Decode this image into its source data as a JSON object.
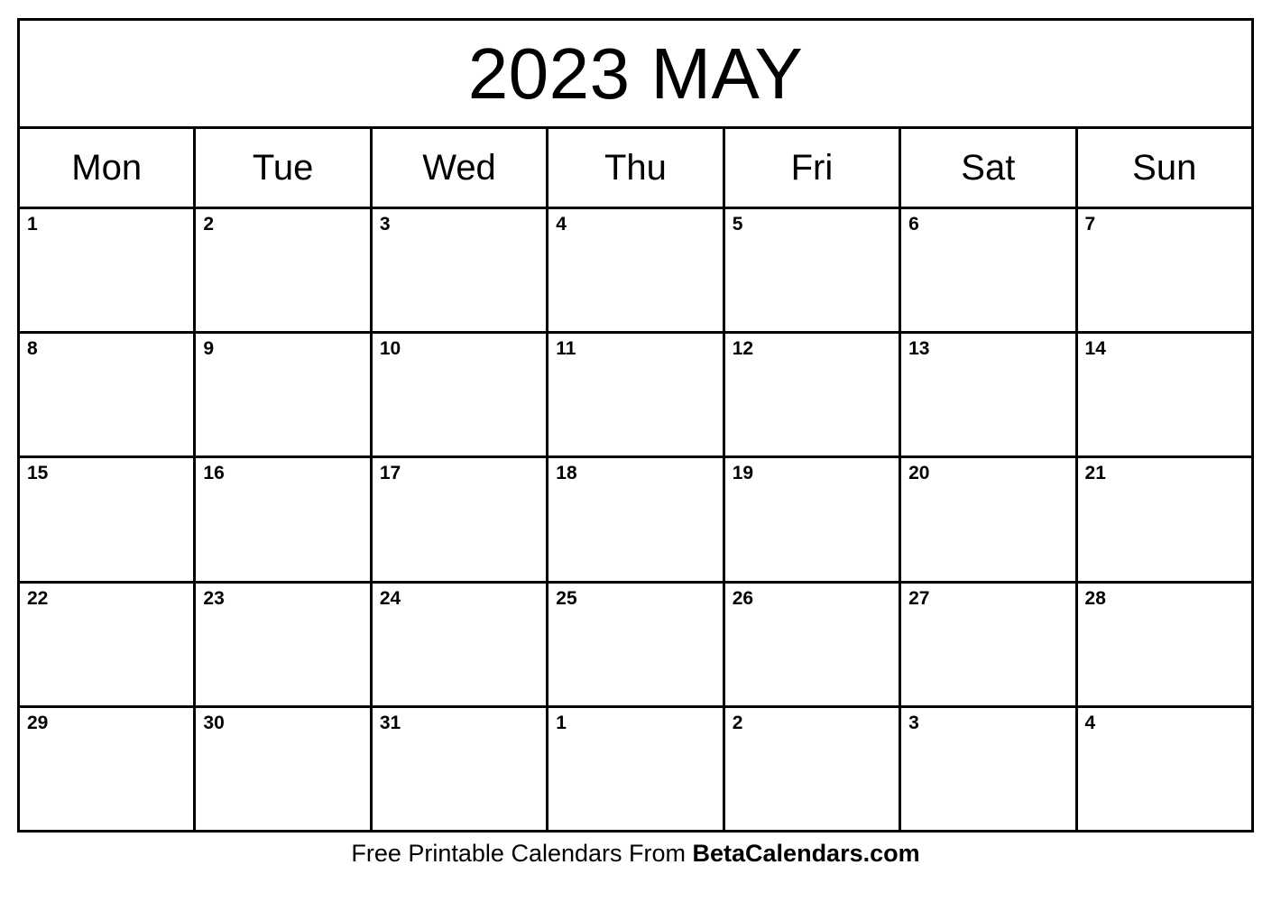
{
  "calendar": {
    "title": "2023 MAY",
    "year": "2023",
    "month": "MAY",
    "weekday_headers": [
      "Mon",
      "Tue",
      "Wed",
      "Thu",
      "Fri",
      "Sat",
      "Sun"
    ],
    "weeks": [
      [
        "1",
        "2",
        "3",
        "4",
        "5",
        "6",
        "7"
      ],
      [
        "8",
        "9",
        "10",
        "11",
        "12",
        "13",
        "14"
      ],
      [
        "15",
        "16",
        "17",
        "18",
        "19",
        "20",
        "21"
      ],
      [
        "22",
        "23",
        "24",
        "25",
        "26",
        "27",
        "28"
      ],
      [
        "29",
        "30",
        "31",
        "1",
        "2",
        "3",
        "4"
      ]
    ],
    "colors": {
      "border": "#000000",
      "background": "#ffffff",
      "text": "#000000"
    }
  },
  "footer": {
    "prefix": "Free Printable Calendars From ",
    "brand": "BetaCalendars.com"
  }
}
